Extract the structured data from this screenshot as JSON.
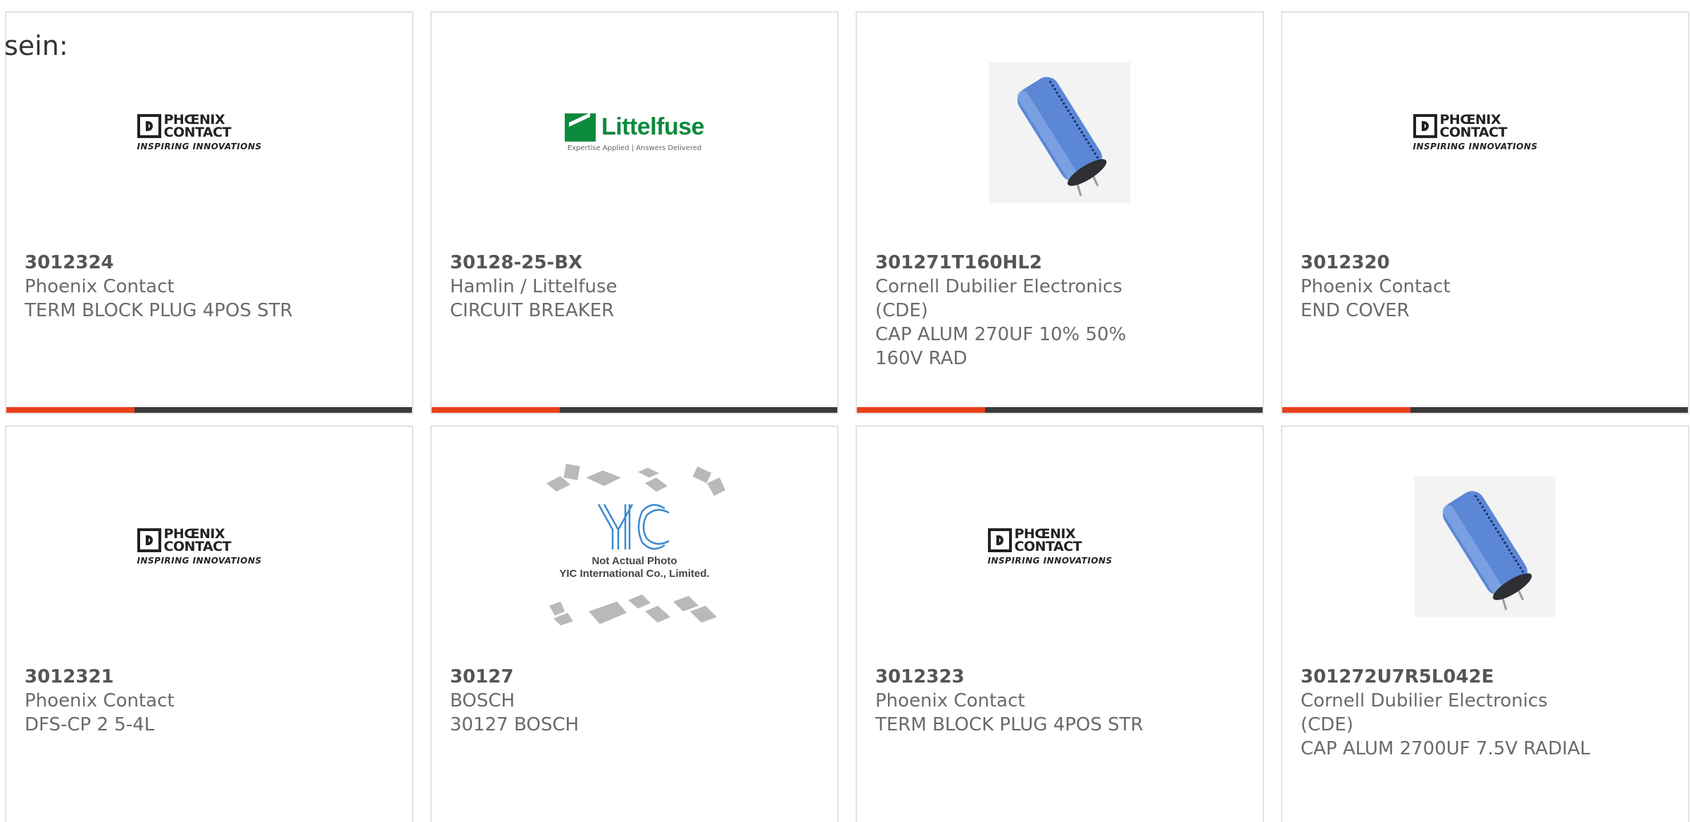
{
  "lead_text": "sein:",
  "colors": {
    "accent": "#e8401c",
    "bar": "#3a3a3a",
    "border": "#e2e2e2"
  },
  "products": [
    {
      "part": "3012324",
      "maker": "Phoenix Contact",
      "desc": "TERM BLOCK PLUG 4POS STR",
      "image": "phoenix-contact-logo"
    },
    {
      "part": "30128-25-BX",
      "maker": "Hamlin / Littelfuse",
      "desc": "CIRCUIT BREAKER",
      "image": "littelfuse-logo"
    },
    {
      "part": "301271T160HL2",
      "maker": "Cornell Dubilier Electronics (CDE)",
      "desc": "CAP ALUM 270UF 10% 50% 160V RAD",
      "image": "capacitor-photo"
    },
    {
      "part": "3012320",
      "maker": "Phoenix Contact",
      "desc": "END COVER",
      "image": "phoenix-contact-logo"
    },
    {
      "part": "3012321",
      "maker": "Phoenix Contact",
      "desc": "DFS-CP 2 5-4L",
      "image": "phoenix-contact-logo"
    },
    {
      "part": "30127",
      "maker": "BOSCH",
      "desc": "30127 BOSCH",
      "image": "yic-placeholder"
    },
    {
      "part": "3012323",
      "maker": "Phoenix Contact",
      "desc": "TERM BLOCK PLUG 4POS STR",
      "image": "phoenix-contact-logo"
    },
    {
      "part": "301272U7R5L042E",
      "maker": "Cornell Dubilier Electronics (CDE)",
      "desc": "CAP ALUM 2700UF 7.5V RADIAL",
      "image": "capacitor-photo"
    }
  ],
  "logos": {
    "phoenix_words": [
      "PHŒNIX",
      "CONTACT"
    ],
    "phoenix_tag": "INSPIRING INNOVATIONS",
    "littelfuse_word": "Littelfuse",
    "littelfuse_sub": "Expertise Applied | Answers Delivered",
    "yic_lines": [
      "Not Actual Photo",
      "YIC International Co., Limited."
    ]
  }
}
